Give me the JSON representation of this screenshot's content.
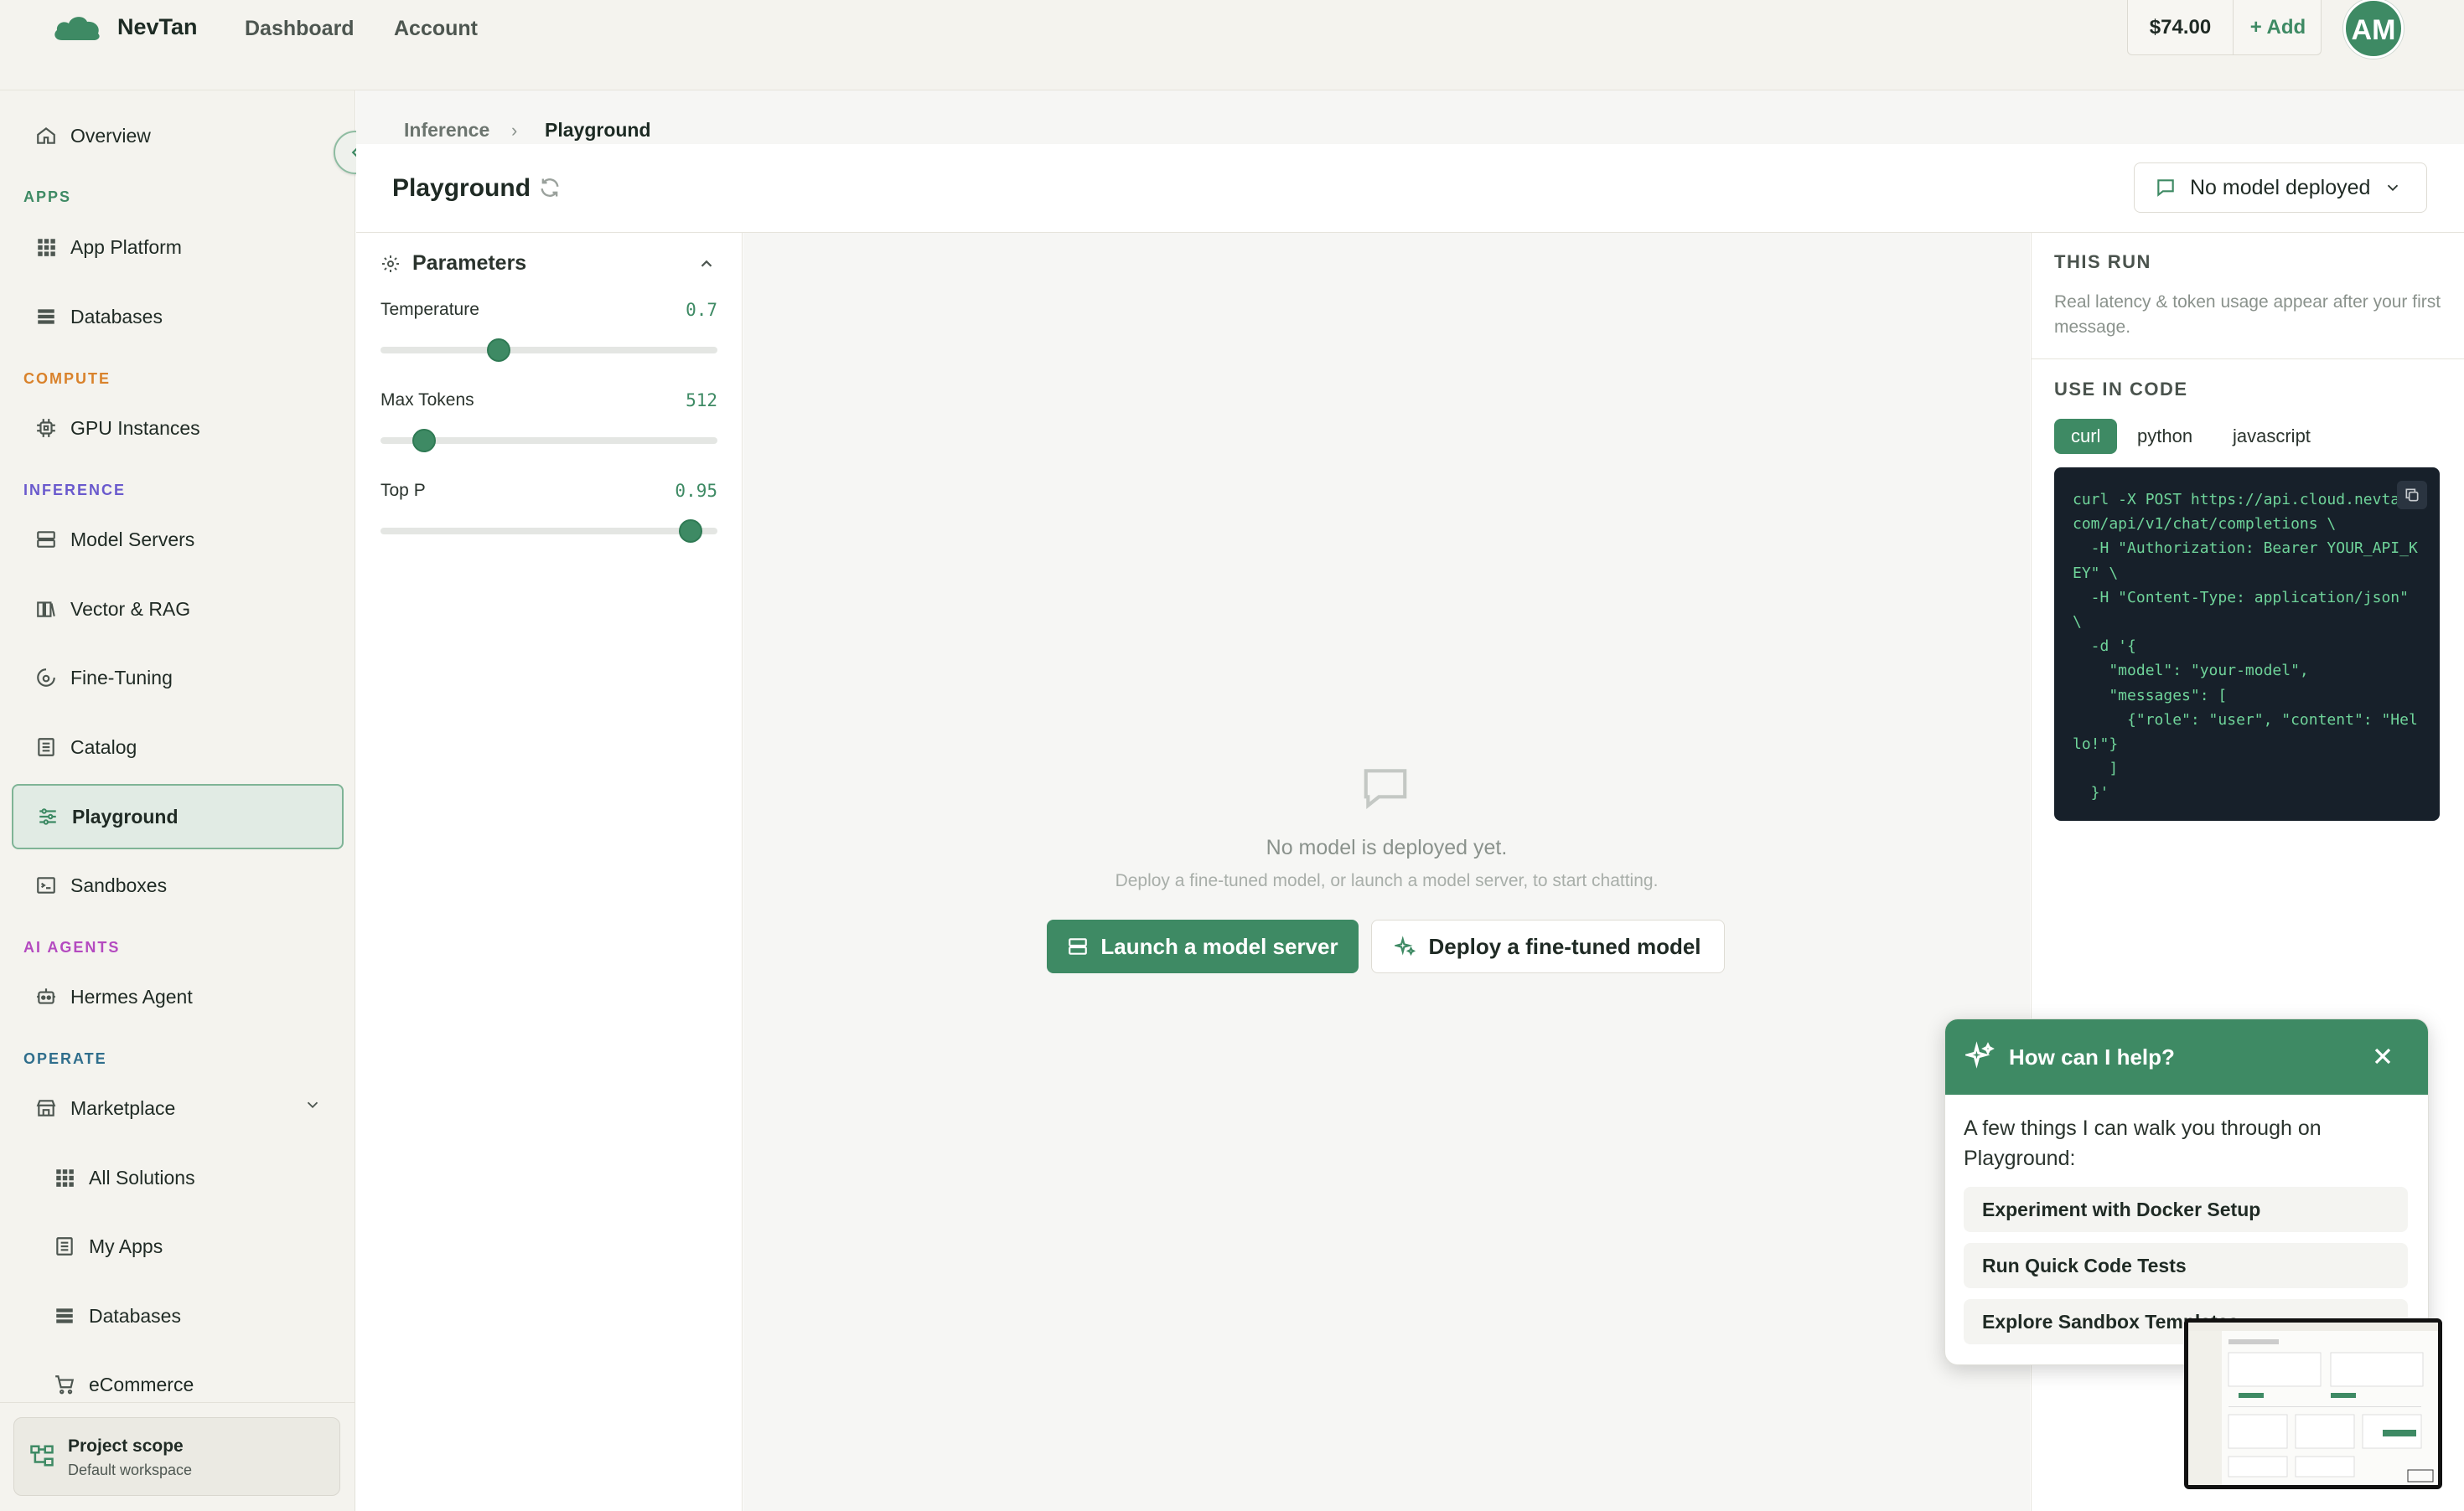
{
  "header": {
    "brand": "NevTan",
    "nav": [
      "Dashboard",
      "Account"
    ],
    "balance": "$74.00",
    "add_label": "+ Add",
    "avatar_initials": "AM"
  },
  "sidebar": {
    "overview": "Overview",
    "sections": {
      "apps": "APPS",
      "compute": "COMPUTE",
      "inference": "INFERENCE",
      "ai_agents": "AI AGENTS",
      "operate": "OPERATE"
    },
    "items": {
      "app_platform": "App Platform",
      "databases": "Databases",
      "gpu_instances": "GPU Instances",
      "model_servers": "Model Servers",
      "vector_rag": "Vector & RAG",
      "fine_tuning": "Fine-Tuning",
      "catalog": "Catalog",
      "playground": "Playground",
      "sandboxes": "Sandboxes",
      "hermes_agent": "Hermes Agent",
      "marketplace": "Marketplace",
      "all_solutions": "All Solutions",
      "my_apps": "My Apps",
      "databases_sub": "Databases",
      "ecommerce": "eCommerce"
    },
    "project": {
      "title": "Project scope",
      "subtitle": "Default workspace"
    },
    "colors": {
      "apps": "#3e8a64",
      "compute": "#d9822b",
      "inference": "#6a5acd",
      "ai_agents": "#b44ac0",
      "operate": "#2f6e8c"
    }
  },
  "breadcrumb": {
    "parent": "Inference",
    "separator": "›",
    "current": "Playground"
  },
  "page": {
    "title": "Playground",
    "model_select": "No model deployed"
  },
  "parameters": {
    "title": "Parameters",
    "items": [
      {
        "label": "Temperature",
        "value": "0.7",
        "fraction": 0.35
      },
      {
        "label": "Max Tokens",
        "value": "512",
        "fraction": 0.13
      },
      {
        "label": "Top P",
        "value": "0.95",
        "fraction": 0.92
      }
    ]
  },
  "empty_state": {
    "title": "No model is deployed yet.",
    "subtitle": "Deploy a fine-tuned model, or launch a model server, to start chatting.",
    "primary_button": "Launch a model server",
    "secondary_button": "Deploy a fine-tuned model"
  },
  "right_panel": {
    "this_run_heading": "THIS RUN",
    "this_run_desc": "Real latency & token usage appear after your first message.",
    "code_heading": "USE IN CODE",
    "tabs": [
      "curl",
      "python",
      "javascript"
    ],
    "active_tab": "curl",
    "code": "curl -X POST https://api.cloud.nevta\ncom/api/v1/chat/completions \\\n  -H \"Authorization: Bearer YOUR_API_K\nEY\" \\\n  -H \"Content-Type: application/json\"\n\\\n  -d '{\n    \"model\": \"your-model\",\n    \"messages\": [\n      {\"role\": \"user\", \"content\": \"Hel\nlo!\"}\n    ]\n  }'"
  },
  "help": {
    "title": "How can I help?",
    "intro": "A few things I can walk you through on Playground:",
    "items": [
      "Experiment with Docker Setup",
      "Run Quick Code Tests",
      "Explore Sandbox Templates"
    ]
  },
  "accent_color": "#3e8a64"
}
